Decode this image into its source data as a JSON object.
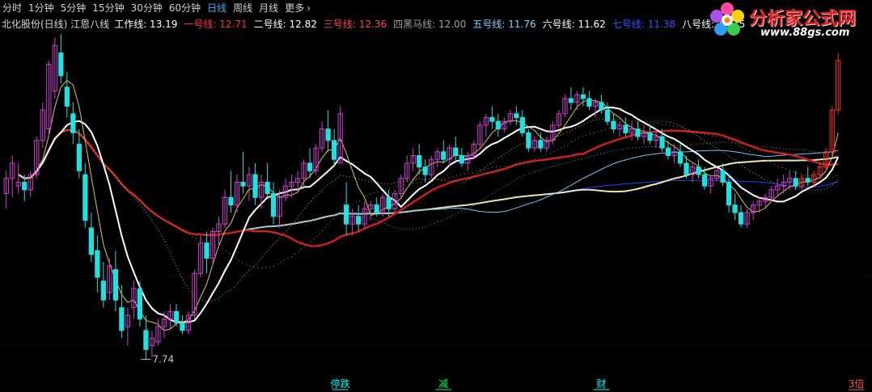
{
  "toolbar": {
    "tabs": [
      {
        "label": "分时",
        "active": false
      },
      {
        "label": "1分钟",
        "active": false
      },
      {
        "label": "5分钟",
        "active": false
      },
      {
        "label": "15分钟",
        "active": false
      },
      {
        "label": "30分钟",
        "active": false
      },
      {
        "label": "60分钟",
        "active": false
      },
      {
        "label": "日线",
        "active": true
      },
      {
        "label": "周线",
        "active": false
      },
      {
        "label": "月线",
        "active": false
      },
      {
        "label": "更多",
        "active": false,
        "icon": "chevron-right-icon"
      }
    ]
  },
  "logo": {
    "brand": "分析家公式网",
    "url": "www.88gs.com",
    "icon": "flower-logo-icon"
  },
  "chart_data": {
    "type": "candlestick",
    "title": "北化股份(日线) 江恩八线",
    "indicators": [
      {
        "name": "工作线",
        "value": "13.19",
        "color": "#ffffff"
      },
      {
        "name": "一号线",
        "value": "12.71",
        "color": "#ff3333"
      },
      {
        "name": "二号线",
        "value": "12.82",
        "color": "#ffffff"
      },
      {
        "name": "三号线",
        "value": "12.36",
        "color": "#ff4444"
      },
      {
        "name": "四黑马线",
        "value": "12.00",
        "color": "#a0a0a0"
      },
      {
        "name": "五号线",
        "value": "11.76",
        "color": "#88ccff"
      },
      {
        "name": "六号线",
        "value": "11.62",
        "color": "#ffffff"
      },
      {
        "name": "七号线",
        "value": "11.38",
        "color": "#3355ff"
      },
      {
        "name": "八号线",
        "value": "12.75",
        "color": "#ffffff"
      }
    ],
    "min_label": "7.74",
    "signals": [
      {
        "label": "停跌",
        "color": "#00ffff",
        "bar": 55
      },
      {
        "label": "减",
        "color": "#00ff66",
        "bar": 72
      },
      {
        "label": "财",
        "color": "#00ffff",
        "bar": 98
      },
      {
        "label": "3倍",
        "color": "#ff5555",
        "bar": 140
      }
    ],
    "bar_count": 142,
    "price_range": [
      7.2,
      16.3
    ],
    "candles": [
      [
        12.1,
        12.7,
        11.7,
        12.5
      ],
      [
        12.5,
        13.1,
        12.0,
        12.9
      ],
      [
        12.3,
        12.9,
        12.1,
        12.4
      ],
      [
        12.4,
        12.6,
        11.9,
        12.2
      ],
      [
        12.2,
        12.7,
        12.0,
        12.6
      ],
      [
        12.6,
        13.6,
        12.5,
        13.5
      ],
      [
        13.5,
        14.5,
        13.3,
        14.3
      ],
      [
        13.8,
        15.6,
        13.6,
        15.5
      ],
      [
        14.8,
        16.2,
        14.6,
        16.0
      ],
      [
        15.8,
        16.3,
        15.0,
        15.2
      ],
      [
        14.9,
        15.3,
        14.1,
        14.4
      ],
      [
        14.2,
        14.5,
        13.4,
        13.7
      ],
      [
        13.4,
        13.8,
        12.5,
        12.7
      ],
      [
        12.6,
        12.9,
        11.2,
        11.4
      ],
      [
        11.2,
        11.6,
        10.3,
        10.5
      ],
      [
        10.6,
        11.0,
        9.5,
        9.9
      ],
      [
        9.8,
        10.3,
        9.1,
        9.3
      ],
      [
        9.5,
        10.4,
        9.3,
        10.2
      ],
      [
        10.1,
        10.6,
        9.0,
        9.3
      ],
      [
        9.1,
        9.7,
        8.3,
        8.5
      ],
      [
        8.6,
        9.1,
        8.1,
        8.9
      ],
      [
        9.1,
        9.8,
        8.8,
        9.6
      ],
      [
        9.6,
        9.8,
        8.6,
        8.8
      ],
      [
        8.5,
        8.9,
        7.74,
        8.0
      ],
      [
        8.1,
        8.5,
        7.8,
        8.3
      ],
      [
        8.2,
        8.8,
        8.1,
        8.6
      ],
      [
        8.6,
        9.0,
        8.3,
        8.8
      ],
      [
        8.8,
        9.2,
        8.5,
        9.0
      ],
      [
        9.0,
        9.2,
        8.6,
        8.7
      ],
      [
        8.7,
        8.9,
        8.4,
        8.5
      ],
      [
        8.5,
        9.0,
        8.4,
        8.9
      ],
      [
        8.9,
        10.1,
        8.8,
        10.0
      ],
      [
        10.0,
        11.0,
        9.9,
        10.8
      ],
      [
        10.8,
        11.1,
        10.0,
        10.4
      ],
      [
        10.4,
        11.2,
        10.2,
        11.1
      ],
      [
        11.1,
        11.5,
        10.7,
        11.3
      ],
      [
        11.3,
        12.2,
        11.2,
        12.0
      ],
      [
        12.0,
        12.7,
        11.6,
        11.8
      ],
      [
        11.8,
        12.6,
        11.6,
        12.4
      ],
      [
        12.4,
        13.2,
        12.1,
        12.3
      ],
      [
        12.3,
        12.8,
        11.9,
        12.6
      ],
      [
        12.6,
        12.9,
        11.8,
        12.0
      ],
      [
        12.0,
        12.6,
        11.7,
        12.4
      ],
      [
        12.4,
        12.9,
        12.0,
        12.1
      ],
      [
        12.1,
        12.4,
        11.3,
        11.5
      ],
      [
        11.5,
        12.2,
        11.2,
        12.0
      ],
      [
        12.0,
        12.5,
        11.9,
        12.3
      ],
      [
        12.3,
        12.6,
        12.0,
        12.4
      ],
      [
        12.4,
        12.7,
        12.2,
        12.5
      ],
      [
        12.5,
        13.0,
        12.3,
        12.9
      ],
      [
        12.9,
        13.3,
        12.5,
        12.7
      ],
      [
        12.7,
        13.4,
        12.6,
        13.3
      ],
      [
        13.3,
        14.0,
        13.2,
        13.8
      ],
      [
        13.8,
        14.3,
        13.2,
        13.5
      ],
      [
        13.5,
        13.8,
        12.8,
        13.0
      ],
      [
        12.9,
        14.4,
        12.9,
        14.2
      ],
      [
        11.8,
        12.4,
        11.0,
        11.3
      ],
      [
        11.3,
        11.7,
        11.0,
        11.5
      ],
      [
        11.5,
        11.8,
        11.1,
        11.3
      ],
      [
        11.3,
        11.9,
        11.2,
        11.7
      ],
      [
        11.7,
        11.9,
        11.4,
        11.8
      ],
      [
        11.8,
        12.0,
        11.5,
        11.6
      ],
      [
        11.6,
        12.1,
        11.5,
        12.0
      ],
      [
        12.0,
        12.2,
        11.5,
        11.7
      ],
      [
        11.7,
        12.2,
        11.6,
        12.1
      ],
      [
        12.1,
        12.6,
        12.0,
        12.5
      ],
      [
        12.5,
        13.1,
        12.4,
        12.9
      ],
      [
        12.9,
        13.3,
        12.7,
        13.1
      ],
      [
        13.1,
        13.4,
        12.6,
        12.8
      ],
      [
        12.8,
        13.0,
        12.4,
        12.6
      ],
      [
        12.6,
        13.1,
        12.5,
        13.0
      ],
      [
        13.0,
        13.3,
        12.8,
        13.2
      ],
      [
        13.2,
        13.5,
        12.9,
        13.0
      ],
      [
        13.0,
        13.4,
        12.8,
        13.3
      ],
      [
        13.3,
        13.6,
        12.9,
        13.1
      ],
      [
        13.1,
        13.3,
        12.8,
        12.9
      ],
      [
        12.9,
        13.2,
        12.7,
        13.1
      ],
      [
        13.1,
        13.5,
        13.0,
        13.4
      ],
      [
        13.4,
        14.0,
        13.3,
        13.9
      ],
      [
        13.9,
        14.2,
        13.6,
        14.1
      ],
      [
        14.1,
        14.4,
        13.8,
        14.0
      ],
      [
        14.0,
        14.2,
        13.6,
        13.8
      ],
      [
        13.8,
        14.1,
        13.7,
        14.0
      ],
      [
        14.0,
        14.3,
        13.9,
        14.2
      ],
      [
        14.2,
        14.4,
        13.9,
        14.1
      ],
      [
        14.1,
        14.3,
        13.6,
        13.7
      ],
      [
        13.7,
        13.8,
        13.2,
        13.3
      ],
      [
        13.3,
        13.6,
        13.2,
        13.5
      ],
      [
        13.5,
        13.7,
        13.2,
        13.3
      ],
      [
        13.3,
        13.6,
        13.2,
        13.5
      ],
      [
        13.5,
        14.0,
        13.4,
        13.9
      ],
      [
        13.9,
        14.3,
        13.8,
        14.2
      ],
      [
        14.2,
        14.7,
        14.1,
        14.6
      ],
      [
        14.6,
        14.9,
        14.3,
        14.5
      ],
      [
        14.5,
        14.8,
        14.3,
        14.7
      ],
      [
        14.7,
        14.9,
        14.4,
        14.6
      ],
      [
        14.6,
        14.8,
        14.3,
        14.4
      ],
      [
        14.4,
        14.6,
        14.1,
        14.5
      ],
      [
        14.5,
        14.7,
        14.2,
        14.3
      ],
      [
        14.3,
        14.5,
        13.9,
        14.0
      ],
      [
        14.0,
        14.2,
        13.7,
        13.8
      ],
      [
        13.8,
        14.0,
        13.6,
        13.9
      ],
      [
        13.9,
        14.1,
        13.6,
        13.7
      ],
      [
        13.7,
        14.0,
        13.5,
        13.8
      ],
      [
        13.8,
        14.0,
        13.5,
        13.6
      ],
      [
        13.6,
        13.9,
        13.4,
        13.7
      ],
      [
        13.7,
        13.9,
        13.4,
        13.5
      ],
      [
        13.5,
        13.8,
        13.3,
        13.6
      ],
      [
        13.6,
        13.8,
        13.2,
        13.3
      ],
      [
        13.3,
        13.5,
        13.0,
        13.1
      ],
      [
        13.1,
        13.4,
        12.9,
        13.2
      ],
      [
        13.2,
        13.4,
        12.8,
        12.9
      ],
      [
        12.9,
        13.1,
        12.5,
        12.6
      ],
      [
        12.6,
        12.9,
        12.4,
        12.8
      ],
      [
        12.8,
        13.0,
        12.5,
        12.6
      ],
      [
        12.6,
        12.8,
        12.2,
        12.3
      ],
      [
        12.3,
        12.6,
        12.1,
        12.5
      ],
      [
        12.5,
        12.8,
        12.4,
        12.7
      ],
      [
        12.7,
        12.9,
        12.3,
        12.4
      ],
      [
        12.4,
        12.6,
        11.6,
        11.8
      ],
      [
        11.8,
        12.1,
        11.4,
        11.6
      ],
      [
        11.6,
        11.8,
        11.2,
        11.3
      ],
      [
        11.3,
        11.7,
        11.2,
        11.6
      ],
      [
        11.6,
        11.9,
        11.4,
        11.8
      ],
      [
        11.8,
        12.0,
        11.6,
        11.9
      ],
      [
        11.9,
        12.1,
        11.7,
        12.0
      ],
      [
        12.0,
        12.3,
        11.9,
        12.2
      ],
      [
        12.2,
        12.5,
        12.0,
        12.3
      ],
      [
        12.3,
        12.6,
        12.1,
        12.4
      ],
      [
        12.4,
        12.7,
        12.2,
        12.5
      ],
      [
        12.5,
        12.7,
        12.2,
        12.3
      ],
      [
        12.3,
        12.6,
        12.2,
        12.5
      ],
      [
        12.5,
        12.8,
        12.3,
        12.4
      ],
      [
        12.4,
        12.7,
        12.3,
        12.6
      ],
      [
        12.6,
        12.9,
        12.5,
        12.8
      ],
      [
        12.8,
        13.3,
        12.7,
        13.2
      ],
      [
        13.2,
        14.4,
        13.1,
        14.3
      ],
      [
        14.3,
        15.8,
        14.2,
        15.6
      ]
    ]
  }
}
